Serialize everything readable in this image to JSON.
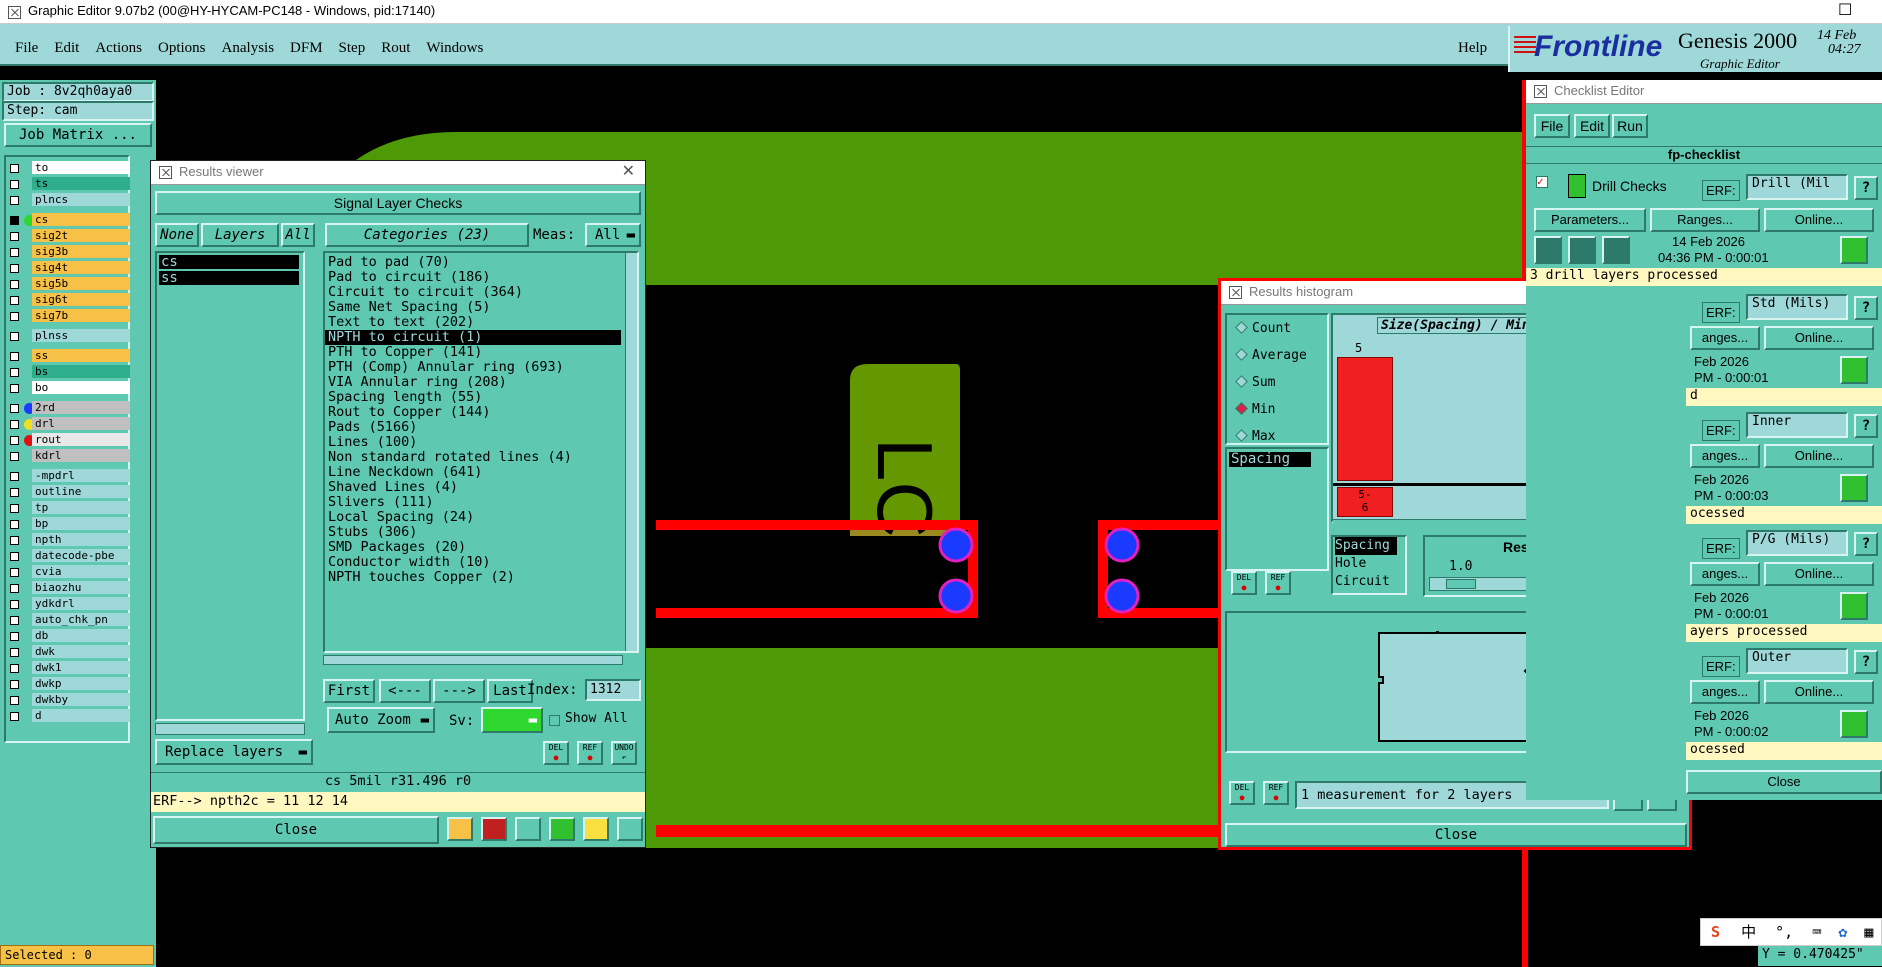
{
  "window": {
    "title": "Graphic Editor 9.07b2 (00@HY-HYCAM-PC148 - Windows, pid:17140)"
  },
  "menubar": {
    "items": [
      "File",
      "Edit",
      "Actions",
      "Options",
      "Analysis",
      "DFM",
      "Step",
      "Rout",
      "Windows"
    ],
    "help": "Help"
  },
  "brand": {
    "logo": "Frontline",
    "product": "Genesis 2000",
    "subtitle": "Graphic Editor",
    "date": "14 Feb",
    "time": "04:27"
  },
  "job": {
    "job_label": "Job : 8v2qh0aya0",
    "step_label": "Step: cam",
    "matrix_button": "Job Matrix ..."
  },
  "layers": [
    {
      "name": "to",
      "color": "#ffffff"
    },
    {
      "name": "ts",
      "color": "#2fae8c"
    },
    {
      "name": "plncs",
      "color": "#9ed8d8"
    },
    {
      "name": "cs",
      "color": "#f7c046"
    },
    {
      "name": "sig2t",
      "color": "#f7c046"
    },
    {
      "name": "sig3b",
      "color": "#f7c046"
    },
    {
      "name": "sig4t",
      "color": "#f7c046"
    },
    {
      "name": "sig5b",
      "color": "#f7c046"
    },
    {
      "name": "sig6t",
      "color": "#f7c046"
    },
    {
      "name": "sig7b",
      "color": "#f7c046"
    },
    {
      "name": "plnss",
      "color": "#9ed8d8"
    },
    {
      "name": "ss",
      "color": "#f7c046"
    },
    {
      "name": "bs",
      "color": "#2fae8c"
    },
    {
      "name": "bo",
      "color": "#ffffff"
    },
    {
      "name": "2rd",
      "color": "#c0c0c0"
    },
    {
      "name": "drl",
      "color": "#c0c0c0"
    },
    {
      "name": "rout",
      "color": "#e8e8e8"
    },
    {
      "name": "kdrl",
      "color": "#c0c0c0"
    },
    {
      "name": "-mpdrl",
      "color": "#9ed8d8"
    },
    {
      "name": "outline",
      "color": "#9ed8d8"
    },
    {
      "name": "tp",
      "color": "#9ed8d8"
    },
    {
      "name": "bp",
      "color": "#9ed8d8"
    },
    {
      "name": "npth",
      "color": "#9ed8d8"
    },
    {
      "name": "datecode-pbe",
      "color": "#9ed8d8"
    },
    {
      "name": "cvia",
      "color": "#9ed8d8"
    },
    {
      "name": "biaozhu",
      "color": "#9ed8d8"
    },
    {
      "name": "ydkdrl",
      "color": "#9ed8d8"
    },
    {
      "name": "auto_chk_pn",
      "color": "#9ed8d8"
    },
    {
      "name": "db",
      "color": "#9ed8d8"
    },
    {
      "name": "dwk",
      "color": "#9ed8d8"
    },
    {
      "name": "dwk1",
      "color": "#9ed8d8"
    },
    {
      "name": "dwkp",
      "color": "#9ed8d8"
    },
    {
      "name": "dwkby",
      "color": "#9ed8d8"
    },
    {
      "name": "d",
      "color": "#9ed8d8"
    }
  ],
  "status": {
    "selected": "Selected : 0",
    "coord": "Y = 0.470425\""
  },
  "canvas": {
    "text": "LC"
  },
  "results_viewer": {
    "title": "Results viewer",
    "header": "Signal Layer Checks",
    "none_btn": "None",
    "layers_btn": "Layers",
    "all_btn": "All",
    "categories_btn": "Categories (23)",
    "meas_label": "Meas:",
    "meas_value": "All",
    "layer_list": [
      "cs",
      "ss"
    ],
    "categories": [
      "Pad to pad (70)",
      "Pad to circuit (186)",
      "Circuit to circuit (364)",
      "Same Net Spacing (5)",
      "Text to text (202)",
      "NPTH to circuit (1)",
      "PTH to Copper (141)",
      "PTH (Comp) Annular ring (693)",
      "VIA Annular ring (208)",
      "Spacing length (55)",
      "Rout to Copper (144)",
      "Pads (5166)",
      "Lines (100)",
      "Non standard rotated lines (4)",
      "Line Neckdown (641)",
      "Shaved Lines (4)",
      "Slivers (111)",
      "Local Spacing (24)",
      "Stubs (306)",
      "SMD Packages (20)",
      "Conductor width (10)",
      "NPTH touches Copper (2)"
    ],
    "selected_category": "NPTH to circuit (1)",
    "first": "First",
    "prev": "<---",
    "next": "--->",
    "last": "Last",
    "index_label": "Index:",
    "index_value": "1312",
    "auto_zoom": "Auto Zoom",
    "sv_label": "Sv:",
    "show_all": "Show All",
    "replace_layers": "Replace layers",
    "del": "DEL",
    "ref": "REF",
    "undo": "UNDO",
    "info": "cs 5mil  r31.496  r0",
    "erf": "ERF--> npth2c = 11 12 14",
    "close": "Close"
  },
  "histogram": {
    "title": "Results histogram",
    "modes": [
      "Count",
      "Average",
      "Sum",
      "Min",
      "Max"
    ],
    "selected_mode": "Min",
    "chart_title": "Size(Spacing) / Min(Spacing)",
    "bar_value": "5",
    "bin_label": "5-\n6",
    "list": [
      "Spacing"
    ],
    "type_list": [
      "Spacing",
      "Hole",
      "Circuit"
    ],
    "resolution_label": "Resolution",
    "resolution_value": "1.0",
    "measurement_text": "1 measurement for 2 layers",
    "del": "DEL",
    "ref": "REF",
    "close": "Close"
  },
  "checklist": {
    "title": "Checklist Editor",
    "menu": [
      "File",
      "Edit",
      "Run"
    ],
    "name": "fp-checklist",
    "drill_title": "Drill Checks",
    "erf_label": "ERF:",
    "rows": [
      {
        "erf": "Drill (Mil",
        "date": "14 Feb 2026",
        "time": "04:36 PM - 0:00:01",
        "status": "3 drill layers processed"
      },
      {
        "erf": "Std (Mils)",
        "date": "Feb 2026",
        "time": "PM - 0:00:01",
        "status": "d"
      },
      {
        "erf": "Inner",
        "date": "Feb 2026",
        "time": "PM - 0:00:03",
        "status": "ocessed"
      },
      {
        "erf": "P/G (Mils)",
        "date": "Feb 2026",
        "time": "PM - 0:00:01",
        "status": "ayers processed"
      },
      {
        "erf": "Outer",
        "date": "Feb 2026",
        "time": "PM - 0:00:02",
        "status": "ocessed"
      }
    ],
    "params_btn": "Parameters...",
    "ranges_btn": "Ranges...",
    "online_btn": "Online...",
    "ranges_short": "anges...",
    "close": "Close"
  },
  "tray": {
    "items": [
      "中"
    ]
  }
}
